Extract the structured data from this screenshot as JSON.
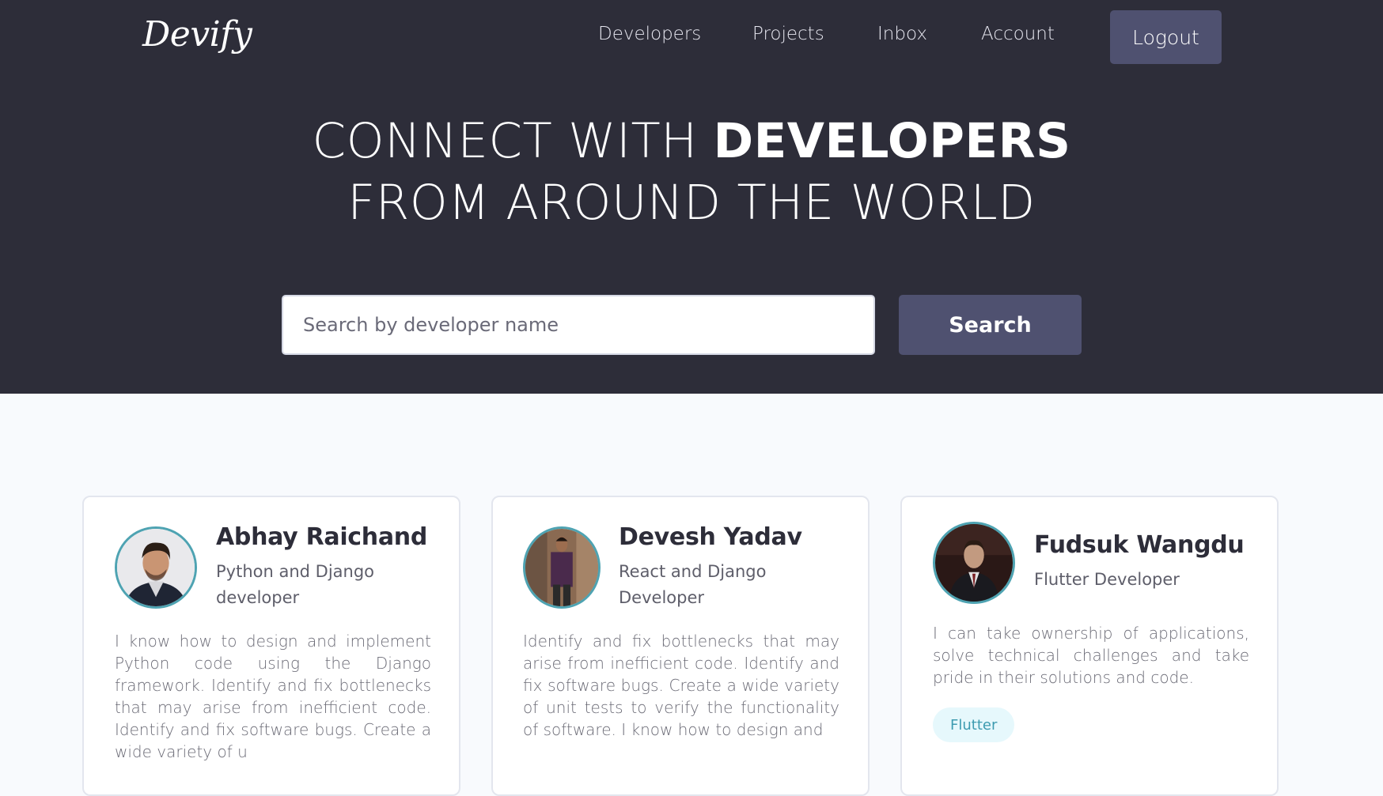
{
  "navbar": {
    "logo": "Devify",
    "links": [
      "Developers",
      "Projects",
      "Inbox",
      "Account"
    ],
    "logout_label": "Logout"
  },
  "hero": {
    "line1_prefix": "CONNECT WITH ",
    "line1_bold": "DEVELOPERS",
    "line2": "FROM AROUND THE WORLD"
  },
  "search": {
    "placeholder": "Search by developer name",
    "button_label": "Search"
  },
  "developers": [
    {
      "name": "Abhay Raichand",
      "role": "Python and Django developer",
      "bio": "I know how to design and implement Python code using the Django framework. Identify and fix bottlenecks that may arise from inefficient code. Identify and fix software bugs. Create a wide variety of u",
      "tags": []
    },
    {
      "name": "Devesh Yadav",
      "role": "React and Django Developer",
      "bio": "Identify and fix bottlenecks that may arise from inefficient code. Identify and fix software bugs. Create a wide variety of unit tests to verify the functionality of software. I know how to design and",
      "tags": []
    },
    {
      "name": "Fudsuk Wangdu",
      "role": "Flutter Developer",
      "bio": "I can take ownership of applications, solve technical challenges and take pride in their solutions and code.",
      "tags": [
        "Flutter"
      ]
    }
  ],
  "colors": {
    "header_bg": "#2d2d39",
    "button_bg": "#4f5170",
    "page_bg": "#f8fafd",
    "avatar_border": "#4ea3b2",
    "tag_bg": "#e6f8fc",
    "tag_text": "#3d9bb0"
  }
}
